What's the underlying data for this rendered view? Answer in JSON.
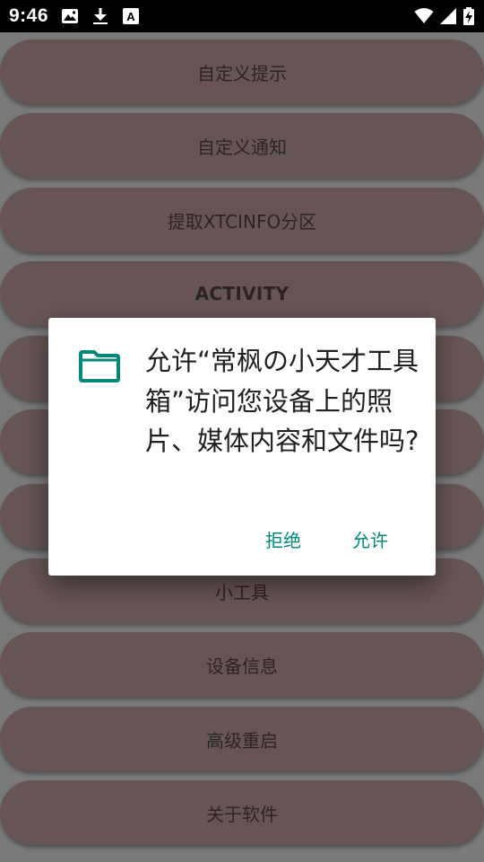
{
  "status_bar": {
    "time": "9:46",
    "icons": [
      "image-icon",
      "download-icon",
      "font-a-icon",
      "wifi-icon",
      "signal-icon",
      "battery-charging-icon"
    ]
  },
  "menu": {
    "items": [
      {
        "label": "自定义提示"
      },
      {
        "label": "自定义通知"
      },
      {
        "label": "提取XTCINFO分区"
      },
      {
        "label": "ACTIVITY"
      },
      {
        "label": ""
      },
      {
        "label": ""
      },
      {
        "label": ""
      },
      {
        "label": "小工具"
      },
      {
        "label": "设备信息"
      },
      {
        "label": "高级重启"
      },
      {
        "label": "关于软件"
      }
    ]
  },
  "dialog": {
    "icon": "folder-icon",
    "message": "允许“常枫の小天才工具箱”访问您设备上的照片、媒体内容和文件吗?",
    "deny_label": "拒绝",
    "allow_label": "允许",
    "accent_color": "#00897b"
  },
  "colors": {
    "button_bg": "#665554",
    "background": "#7a7a7a"
  }
}
